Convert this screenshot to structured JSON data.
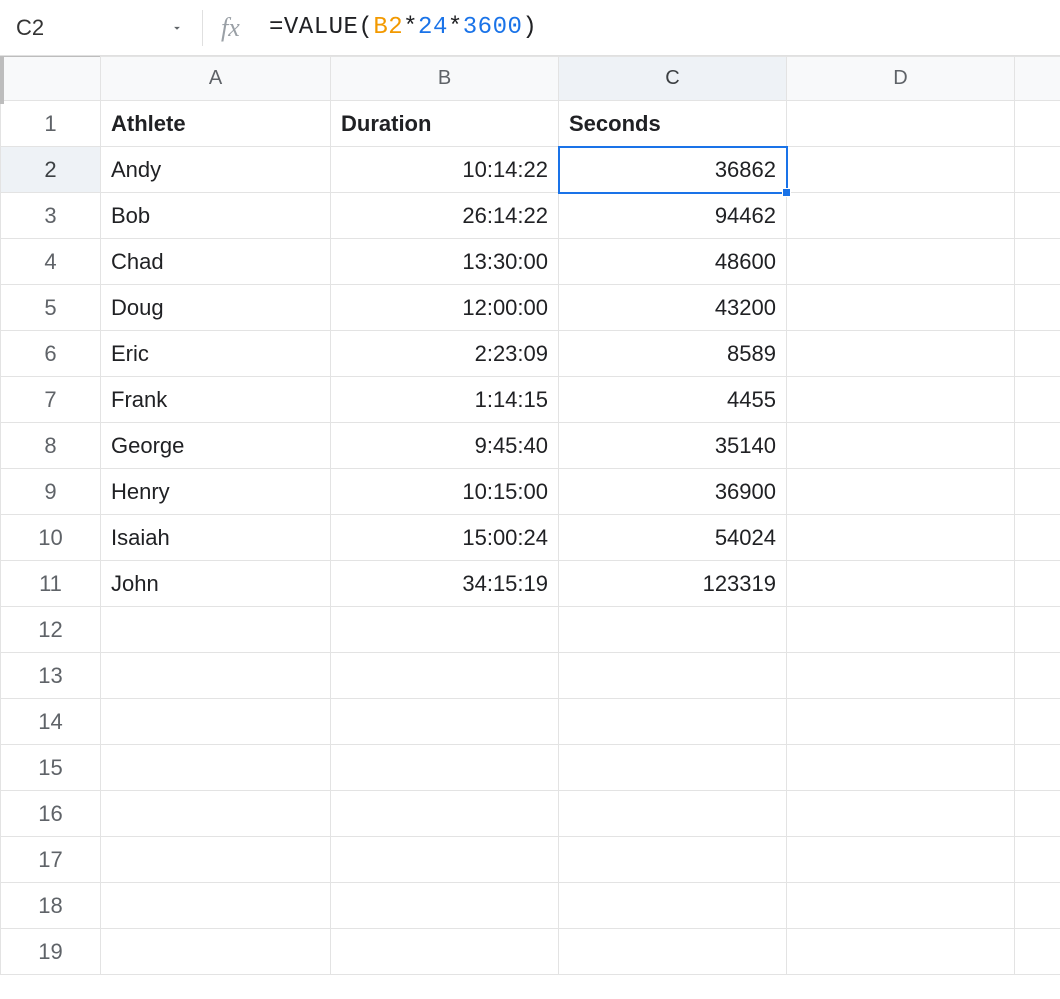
{
  "name_box": {
    "value": "C2"
  },
  "formula": {
    "raw": "=VALUE(B2*24*3600)",
    "tokens": [
      {
        "t": "=VALUE",
        "cls": "tok-func"
      },
      {
        "t": "(",
        "cls": "tok-op"
      },
      {
        "t": "B2",
        "cls": "tok-ref"
      },
      {
        "t": "*",
        "cls": "tok-op"
      },
      {
        "t": "24",
        "cls": "tok-num"
      },
      {
        "t": "*",
        "cls": "tok-op"
      },
      {
        "t": "3600",
        "cls": "tok-num"
      },
      {
        "t": ")",
        "cls": "tok-op"
      }
    ]
  },
  "columns": [
    "A",
    "B",
    "C",
    "D"
  ],
  "row_count": 19,
  "selected_cell": "C2",
  "selected_row": 2,
  "selected_col": "C",
  "headers": {
    "A": "Athlete",
    "B": "Duration",
    "C": "Seconds"
  },
  "rows": [
    {
      "n": 2,
      "A": "Andy",
      "B": "10:14:22",
      "C": "36862"
    },
    {
      "n": 3,
      "A": "Bob",
      "B": "26:14:22",
      "C": "94462"
    },
    {
      "n": 4,
      "A": "Chad",
      "B": "13:30:00",
      "C": "48600"
    },
    {
      "n": 5,
      "A": "Doug",
      "B": "12:00:00",
      "C": "43200"
    },
    {
      "n": 6,
      "A": "Eric",
      "B": "2:23:09",
      "C": "8589"
    },
    {
      "n": 7,
      "A": "Frank",
      "B": "1:14:15",
      "C": "4455"
    },
    {
      "n": 8,
      "A": "George",
      "B": "9:45:40",
      "C": "35140"
    },
    {
      "n": 9,
      "A": "Henry",
      "B": "10:15:00",
      "C": "36900"
    },
    {
      "n": 10,
      "A": "Isaiah",
      "B": "15:00:24",
      "C": "54024"
    },
    {
      "n": 11,
      "A": "John",
      "B": "34:15:19",
      "C": "123319"
    }
  ],
  "chart_data": {
    "type": "table",
    "title": "Athlete duration converted to seconds",
    "columns": [
      "Athlete",
      "Duration",
      "Seconds"
    ],
    "rows": [
      [
        "Andy",
        "10:14:22",
        36862
      ],
      [
        "Bob",
        "26:14:22",
        94462
      ],
      [
        "Chad",
        "13:30:00",
        48600
      ],
      [
        "Doug",
        "12:00:00",
        43200
      ],
      [
        "Eric",
        "2:23:09",
        8589
      ],
      [
        "Frank",
        "1:14:15",
        4455
      ],
      [
        "George",
        "9:45:40",
        35140
      ],
      [
        "Henry",
        "10:15:00",
        36900
      ],
      [
        "Isaiah",
        "15:00:24",
        54024
      ],
      [
        "John",
        "34:15:19",
        123319
      ]
    ]
  }
}
